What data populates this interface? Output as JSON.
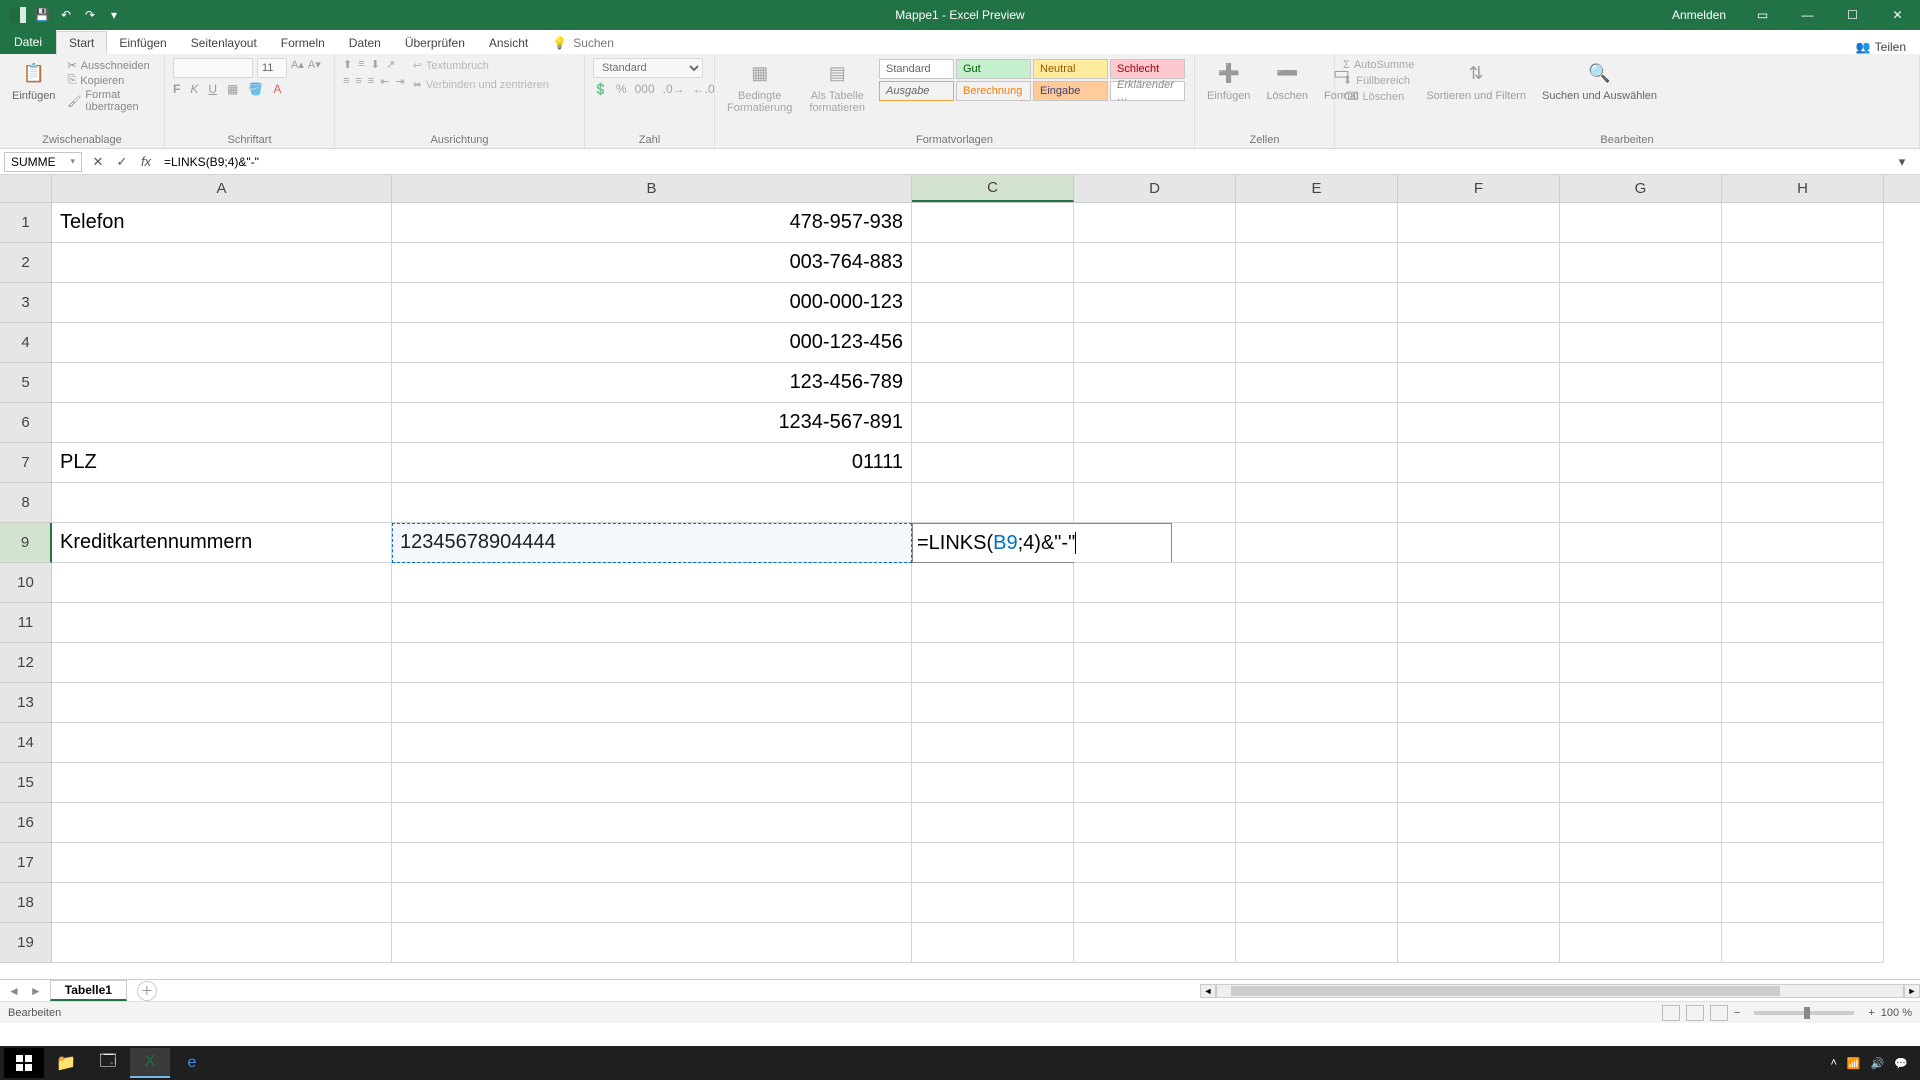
{
  "titlebar": {
    "title": "Mappe1 - Excel Preview",
    "signin": "Anmelden"
  },
  "tabs": {
    "file": "Datei",
    "home": "Start",
    "insert": "Einfügen",
    "layout": "Seitenlayout",
    "formulas": "Formeln",
    "data": "Daten",
    "review": "Überprüfen",
    "view": "Ansicht",
    "search": "Suchen",
    "share": "Teilen"
  },
  "ribbon": {
    "clipboard": {
      "label": "Zwischenablage",
      "paste": "Einfügen",
      "cut": "Ausschneiden",
      "copy": "Kopieren",
      "format_painter": "Format übertragen"
    },
    "font": {
      "label": "Schriftart",
      "size": "11"
    },
    "alignment": {
      "label": "Ausrichtung",
      "wrap": "Textumbruch",
      "merge": "Verbinden und zentrieren"
    },
    "number": {
      "label": "Zahl",
      "format": "Standard"
    },
    "styles": {
      "label": "Formatvorlagen",
      "cond": "Bedingte Formatierung",
      "table": "Als Tabelle formatieren",
      "standard": "Standard",
      "good": "Gut",
      "neutral": "Neutral",
      "bad": "Schlecht",
      "output": "Ausgabe",
      "calc": "Berechnung",
      "input": "Eingabe",
      "explan": "Erklärender …"
    },
    "cells": {
      "label": "Zellen",
      "insert": "Einfügen",
      "delete": "Löschen",
      "format": "Format"
    },
    "editing": {
      "label": "Bearbeiten",
      "autosum": "AutoSumme",
      "fill": "Füllbereich",
      "clear": "Löschen",
      "sort": "Sortieren und Filtern",
      "find": "Suchen und Auswählen"
    }
  },
  "formula_bar": {
    "name": "SUMME",
    "formula": "=LINKS(B9;4)&\"-\""
  },
  "columns": [
    "A",
    "B",
    "C",
    "D",
    "E",
    "F",
    "G",
    "H"
  ],
  "active_cell": "C9",
  "referenced_cell": "B9",
  "cells": {
    "A1": "Telefon",
    "B1": "478-957-938",
    "B2": "003-764-883",
    "B3": "000-000-123",
    "B4": "000-123-456",
    "B5": "123-456-789",
    "B6": "1234-567-891",
    "A7": "PLZ",
    "B7": "01111",
    "A9": "Kreditkartennummern",
    "B9": "12345678904444",
    "C9_formula_pre": "=LINKS(",
    "C9_formula_ref": "B9",
    "C9_formula_post": ";4)&\"-\""
  },
  "sheet": {
    "name": "Tabelle1"
  },
  "status": {
    "mode": "Bearbeiten",
    "zoom": "100 %"
  },
  "taskbar": {
    "time": ""
  }
}
